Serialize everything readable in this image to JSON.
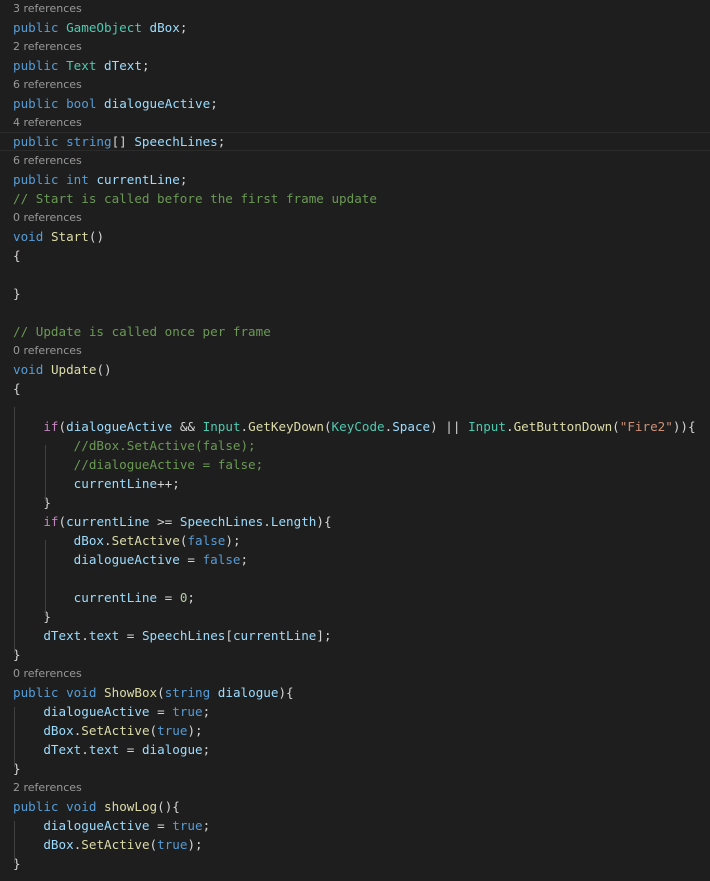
{
  "editor": {
    "theme": {
      "background": "#1e1e1e",
      "keyword": "#569cd6",
      "type": "#4ec9b0",
      "function": "#dcdcaa",
      "variable": "#9cdcfe",
      "comment": "#6a9955",
      "string": "#ce9178",
      "number": "#b5cea8",
      "codelens": "#999999"
    },
    "rows": [
      {
        "kind": "lens",
        "text": "3 references"
      },
      {
        "kind": "code",
        "tokens": [
          [
            "kw",
            "public"
          ],
          [
            "pl",
            " "
          ],
          [
            "ty",
            "GameObject"
          ],
          [
            "pl",
            " "
          ],
          [
            "var",
            "dBox"
          ],
          [
            "pl",
            ";"
          ]
        ]
      },
      {
        "kind": "lens",
        "text": "2 references"
      },
      {
        "kind": "code",
        "tokens": [
          [
            "kw",
            "public"
          ],
          [
            "pl",
            " "
          ],
          [
            "ty",
            "Text"
          ],
          [
            "pl",
            " "
          ],
          [
            "var",
            "dText"
          ],
          [
            "pl",
            ";"
          ]
        ]
      },
      {
        "kind": "lens",
        "text": "6 references"
      },
      {
        "kind": "code",
        "tokens": [
          [
            "kw",
            "public"
          ],
          [
            "pl",
            " "
          ],
          [
            "kw",
            "bool"
          ],
          [
            "pl",
            " "
          ],
          [
            "var",
            "dialogueActive"
          ],
          [
            "pl",
            ";"
          ]
        ]
      },
      {
        "kind": "lens",
        "text": "4 references"
      },
      {
        "kind": "code",
        "current": true,
        "tokens": [
          [
            "kw",
            "public"
          ],
          [
            "pl",
            " "
          ],
          [
            "kw",
            "string"
          ],
          [
            "pl",
            "[] "
          ],
          [
            "var",
            "SpeechLines"
          ],
          [
            "pl",
            ";"
          ]
        ]
      },
      {
        "kind": "lens",
        "text": "6 references"
      },
      {
        "kind": "code",
        "tokens": [
          [
            "kw",
            "public"
          ],
          [
            "pl",
            " "
          ],
          [
            "kw",
            "int"
          ],
          [
            "pl",
            " "
          ],
          [
            "var",
            "currentLine"
          ],
          [
            "pl",
            ";"
          ]
        ]
      },
      {
        "kind": "code",
        "tokens": [
          [
            "cm",
            "// Start is called before the first frame update"
          ]
        ]
      },
      {
        "kind": "lens",
        "text": "0 references"
      },
      {
        "kind": "code",
        "tokens": [
          [
            "kw",
            "void"
          ],
          [
            "pl",
            " "
          ],
          [
            "fn",
            "Start"
          ],
          [
            "pl",
            "()"
          ]
        ]
      },
      {
        "kind": "code",
        "tokens": [
          [
            "pl",
            "{"
          ]
        ]
      },
      {
        "kind": "code",
        "tokens": []
      },
      {
        "kind": "code",
        "tokens": [
          [
            "pl",
            "}"
          ]
        ]
      },
      {
        "kind": "code",
        "tokens": []
      },
      {
        "kind": "code",
        "tokens": [
          [
            "cm",
            "// Update is called once per frame"
          ]
        ]
      },
      {
        "kind": "lens",
        "text": "0 references"
      },
      {
        "kind": "code",
        "tokens": [
          [
            "kw",
            "void"
          ],
          [
            "pl",
            " "
          ],
          [
            "fn",
            "Update"
          ],
          [
            "pl",
            "()"
          ]
        ]
      },
      {
        "kind": "code",
        "tokens": [
          [
            "pl",
            "{"
          ]
        ]
      },
      {
        "kind": "code",
        "tokens": []
      },
      {
        "kind": "code",
        "tokens": [
          [
            "pl",
            "    "
          ],
          [
            "kwc",
            "if"
          ],
          [
            "pl",
            "("
          ],
          [
            "var",
            "dialogueActive"
          ],
          [
            "pl",
            " && "
          ],
          [
            "ty",
            "Input"
          ],
          [
            "pl",
            "."
          ],
          [
            "fn",
            "GetKeyDown"
          ],
          [
            "pl",
            "("
          ],
          [
            "ty",
            "KeyCode"
          ],
          [
            "pl",
            "."
          ],
          [
            "var",
            "Space"
          ],
          [
            "pl",
            ") || "
          ],
          [
            "ty",
            "Input"
          ],
          [
            "pl",
            "."
          ],
          [
            "fn",
            "GetButtonDown"
          ],
          [
            "pl",
            "("
          ],
          [
            "str",
            "\"Fire2\""
          ],
          [
            "pl",
            "))"
          ],
          [
            "pl",
            "{"
          ]
        ]
      },
      {
        "kind": "code",
        "tokens": [
          [
            "pl",
            "        "
          ],
          [
            "cm",
            "//dBox.SetActive(false);"
          ]
        ]
      },
      {
        "kind": "code",
        "tokens": [
          [
            "pl",
            "        "
          ],
          [
            "cm",
            "//dialogueActive = false;"
          ]
        ]
      },
      {
        "kind": "code",
        "tokens": [
          [
            "pl",
            "        "
          ],
          [
            "var",
            "currentLine"
          ],
          [
            "pl",
            "++;"
          ]
        ]
      },
      {
        "kind": "code",
        "tokens": [
          [
            "pl",
            "    }"
          ]
        ]
      },
      {
        "kind": "code",
        "tokens": [
          [
            "pl",
            "    "
          ],
          [
            "kwc",
            "if"
          ],
          [
            "pl",
            "("
          ],
          [
            "var",
            "currentLine"
          ],
          [
            "pl",
            " >= "
          ],
          [
            "var",
            "SpeechLines"
          ],
          [
            "pl",
            "."
          ],
          [
            "var",
            "Length"
          ],
          [
            "pl",
            "){"
          ]
        ]
      },
      {
        "kind": "code",
        "tokens": [
          [
            "pl",
            "        "
          ],
          [
            "var",
            "dBox"
          ],
          [
            "pl",
            "."
          ],
          [
            "fn",
            "SetActive"
          ],
          [
            "pl",
            "("
          ],
          [
            "kw",
            "false"
          ],
          [
            "pl",
            ");"
          ]
        ]
      },
      {
        "kind": "code",
        "tokens": [
          [
            "pl",
            "        "
          ],
          [
            "var",
            "dialogueActive"
          ],
          [
            "pl",
            " = "
          ],
          [
            "kw",
            "false"
          ],
          [
            "pl",
            ";"
          ]
        ]
      },
      {
        "kind": "code",
        "tokens": []
      },
      {
        "kind": "code",
        "tokens": [
          [
            "pl",
            "        "
          ],
          [
            "var",
            "currentLine"
          ],
          [
            "pl",
            " = "
          ],
          [
            "num",
            "0"
          ],
          [
            "pl",
            ";"
          ]
        ]
      },
      {
        "kind": "code",
        "tokens": [
          [
            "pl",
            "    }"
          ]
        ]
      },
      {
        "kind": "code",
        "tokens": [
          [
            "pl",
            "    "
          ],
          [
            "var",
            "dText"
          ],
          [
            "pl",
            "."
          ],
          [
            "var",
            "text"
          ],
          [
            "pl",
            " = "
          ],
          [
            "var",
            "SpeechLines"
          ],
          [
            "pl",
            "["
          ],
          [
            "var",
            "currentLine"
          ],
          [
            "pl",
            "];"
          ]
        ]
      },
      {
        "kind": "code",
        "tokens": [
          [
            "pl",
            "}"
          ]
        ]
      },
      {
        "kind": "lens",
        "text": "0 references"
      },
      {
        "kind": "code",
        "tokens": [
          [
            "kw",
            "public"
          ],
          [
            "pl",
            " "
          ],
          [
            "kw",
            "void"
          ],
          [
            "pl",
            " "
          ],
          [
            "fn",
            "ShowBox"
          ],
          [
            "pl",
            "("
          ],
          [
            "kw",
            "string"
          ],
          [
            "pl",
            " "
          ],
          [
            "var",
            "dialogue"
          ],
          [
            "pl",
            "){"
          ]
        ]
      },
      {
        "kind": "code",
        "tokens": [
          [
            "pl",
            "    "
          ],
          [
            "var",
            "dialogueActive"
          ],
          [
            "pl",
            " = "
          ],
          [
            "kw",
            "true"
          ],
          [
            "pl",
            ";"
          ]
        ]
      },
      {
        "kind": "code",
        "tokens": [
          [
            "pl",
            "    "
          ],
          [
            "var",
            "dBox"
          ],
          [
            "pl",
            "."
          ],
          [
            "fn",
            "SetActive"
          ],
          [
            "pl",
            "("
          ],
          [
            "kw",
            "true"
          ],
          [
            "pl",
            ");"
          ]
        ]
      },
      {
        "kind": "code",
        "tokens": [
          [
            "pl",
            "    "
          ],
          [
            "var",
            "dText"
          ],
          [
            "pl",
            "."
          ],
          [
            "var",
            "text"
          ],
          [
            "pl",
            " = "
          ],
          [
            "var",
            "dialogue"
          ],
          [
            "pl",
            ";"
          ]
        ]
      },
      {
        "kind": "code",
        "tokens": [
          [
            "pl",
            "}"
          ]
        ]
      },
      {
        "kind": "lens",
        "text": "2 references"
      },
      {
        "kind": "code",
        "tokens": [
          [
            "kw",
            "public"
          ],
          [
            "pl",
            " "
          ],
          [
            "kw",
            "void"
          ],
          [
            "pl",
            " "
          ],
          [
            "fn",
            "showLog"
          ],
          [
            "pl",
            "(){"
          ]
        ]
      },
      {
        "kind": "code",
        "tokens": [
          [
            "pl",
            "    "
          ],
          [
            "var",
            "dialogueActive"
          ],
          [
            "pl",
            " = "
          ],
          [
            "kw",
            "true"
          ],
          [
            "pl",
            ";"
          ]
        ]
      },
      {
        "kind": "code",
        "tokens": [
          [
            "pl",
            "    "
          ],
          [
            "var",
            "dBox"
          ],
          [
            "pl",
            "."
          ],
          [
            "fn",
            "SetActive"
          ],
          [
            "pl",
            "("
          ],
          [
            "kw",
            "true"
          ],
          [
            "pl",
            ");"
          ]
        ]
      },
      {
        "kind": "code",
        "tokens": [
          [
            "pl",
            "}"
          ]
        ]
      }
    ]
  }
}
